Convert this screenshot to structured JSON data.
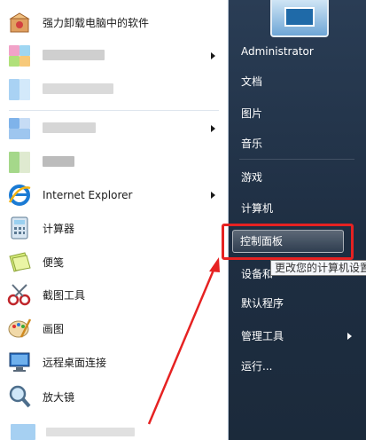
{
  "left_panel": {
    "items": [
      {
        "label": "强力卸载电脑中的软件",
        "icon": "uninstall-box-icon",
        "has_arrow": false
      },
      {
        "label": "",
        "icon": "blurred-app-icon",
        "has_arrow": true
      },
      {
        "label": "",
        "icon": "blurred-app-icon",
        "has_arrow": false
      },
      {
        "label": "",
        "icon": "blurred-app-icon",
        "has_arrow": true
      },
      {
        "label": "",
        "icon": "blurred-app-icon",
        "has_arrow": false
      },
      {
        "label": "Internet Explorer",
        "icon": "internet-explorer-icon",
        "has_arrow": true
      },
      {
        "label": "计算器",
        "icon": "calculator-icon",
        "has_arrow": false
      },
      {
        "label": "便笺",
        "icon": "sticky-notes-icon",
        "has_arrow": false
      },
      {
        "label": "截图工具",
        "icon": "snipping-tool-icon",
        "has_arrow": false
      },
      {
        "label": "画图",
        "icon": "paint-icon",
        "has_arrow": false
      },
      {
        "label": "远程桌面连接",
        "icon": "remote-desktop-icon",
        "has_arrow": false
      },
      {
        "label": "放大镜",
        "icon": "magnifier-icon",
        "has_arrow": false
      }
    ]
  },
  "right_panel": {
    "items": [
      {
        "label": "Administrator",
        "has_arrow": false
      },
      {
        "label": "文档",
        "has_arrow": false
      },
      {
        "label": "图片",
        "has_arrow": false
      },
      {
        "label": "音乐",
        "has_arrow": false
      },
      {
        "label": "游戏",
        "has_arrow": false
      },
      {
        "label": "计算机",
        "has_arrow": false
      },
      {
        "label": "控制面板",
        "has_arrow": false,
        "active": true
      },
      {
        "label": "设备和",
        "has_arrow": false
      },
      {
        "label": "默认程序",
        "has_arrow": false
      },
      {
        "label": "管理工具",
        "has_arrow": true
      },
      {
        "label": "运行...",
        "has_arrow": false
      }
    ]
  },
  "tooltip": {
    "text": "更改您的计算机设置"
  },
  "colors": {
    "highlight": "#e62222",
    "annotation_arrow": "#e62222"
  }
}
